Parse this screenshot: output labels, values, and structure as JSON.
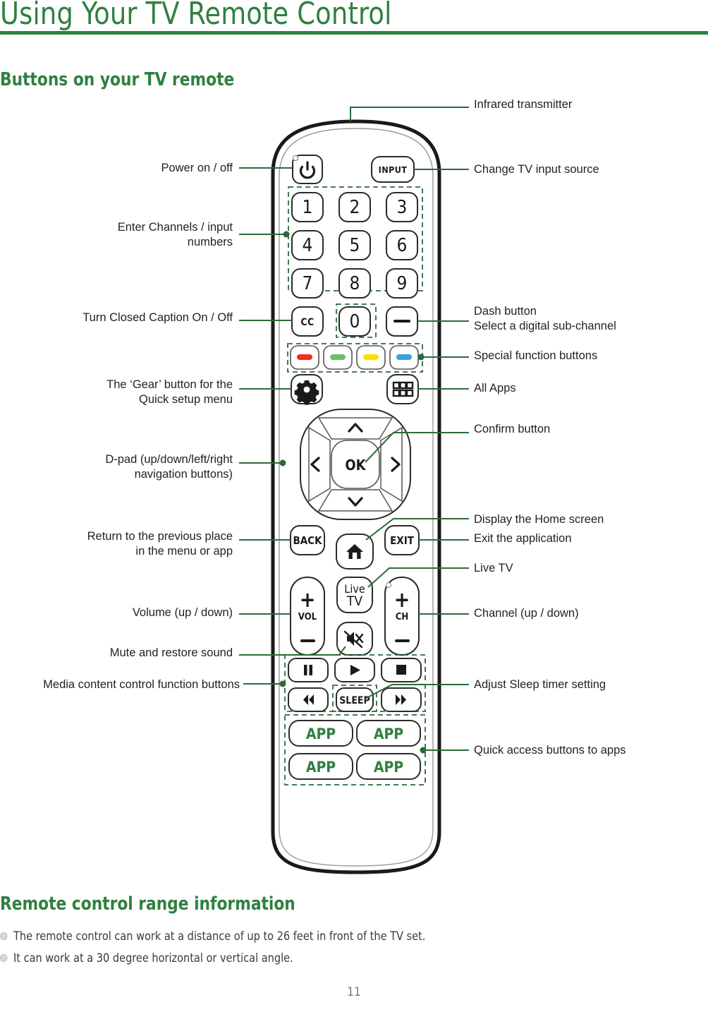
{
  "document": {
    "title": "Using Your TV Remote Control",
    "page_number": "11"
  },
  "sections": {
    "buttons_heading": "Buttons on your TV remote",
    "range_heading": "Remote control range information",
    "range_bullets": [
      "The remote control can work at a distance of up to 26 feet in front of the TV set.",
      "It can work at a 30 degree horizontal or vertical angle."
    ]
  },
  "callouts": {
    "left": [
      {
        "id": "power",
        "text": "Power on / off"
      },
      {
        "id": "numbers",
        "text": "Enter Channels / input\nnumbers"
      },
      {
        "id": "cc",
        "text": "Turn Closed Caption On / Off"
      },
      {
        "id": "gear",
        "text": "The ‘Gear’ button for the\nQuick setup menu"
      },
      {
        "id": "dpad",
        "text": "D-pad (up/down/left/right\nnavigation buttons)"
      },
      {
        "id": "back",
        "text": "Return to the previous place\nin the menu or app"
      },
      {
        "id": "vol",
        "text": "Volume (up / down)"
      },
      {
        "id": "mute",
        "text": "Mute and restore sound"
      },
      {
        "id": "media",
        "text": "Media content control function buttons"
      }
    ],
    "right": [
      {
        "id": "ir",
        "text": "Infrared transmitter"
      },
      {
        "id": "input",
        "text": "Change TV input source"
      },
      {
        "id": "dash",
        "text": "Dash button\nSelect a digital sub-channel"
      },
      {
        "id": "special",
        "text": "Special function buttons"
      },
      {
        "id": "allapps",
        "text": "All Apps"
      },
      {
        "id": "ok",
        "text": "Confirm button"
      },
      {
        "id": "home",
        "text": "Display the Home screen"
      },
      {
        "id": "exit",
        "text": "Exit the application"
      },
      {
        "id": "livetv",
        "text": "Live TV"
      },
      {
        "id": "ch",
        "text": "Channel (up / down)"
      },
      {
        "id": "sleep",
        "text": "Adjust Sleep timer setting"
      },
      {
        "id": "apps",
        "text": "Quick access buttons to apps"
      }
    ]
  },
  "remote": {
    "power_label": "⏻",
    "input_label": "INPUT",
    "number_keys": [
      "1",
      "2",
      "3",
      "4",
      "5",
      "6",
      "7",
      "8",
      "9"
    ],
    "cc_label": "CC",
    "zero_label": "0",
    "dash_label": "—",
    "color_buttons": [
      {
        "name": "red",
        "color": "#ee2e24"
      },
      {
        "name": "green",
        "color": "#6dbe6a"
      },
      {
        "name": "yellow",
        "color": "#ffdd00"
      },
      {
        "name": "blue",
        "color": "#3b9fe0"
      }
    ],
    "gear_label": "gear-icon",
    "allapps_label": "grid-icon",
    "dpad": {
      "up": "⌃",
      "down": "⌄",
      "left": "‹",
      "right": "›",
      "ok": "OK"
    },
    "back_label": "BACK",
    "exit_label": "EXIT",
    "home_label": "home-icon",
    "livetv_label_line1": "Live",
    "livetv_label_line2": "TV",
    "vol_label": "VOL",
    "ch_label": "CH",
    "plus_label": "+",
    "minus_label": "–",
    "mute_label": "mute-icon",
    "media_buttons": [
      "▐▌",
      "▶",
      "■",
      "◀◀",
      "SLEEP",
      "▶▶"
    ],
    "sleep_label": "SLEEP",
    "app_buttons": [
      "APP",
      "APP",
      "APP",
      "APP"
    ]
  },
  "colors": {
    "brand_green": "#2f8040",
    "callout_line": "#2b6b3a",
    "text": "#231f20",
    "outline": "#231f20"
  }
}
